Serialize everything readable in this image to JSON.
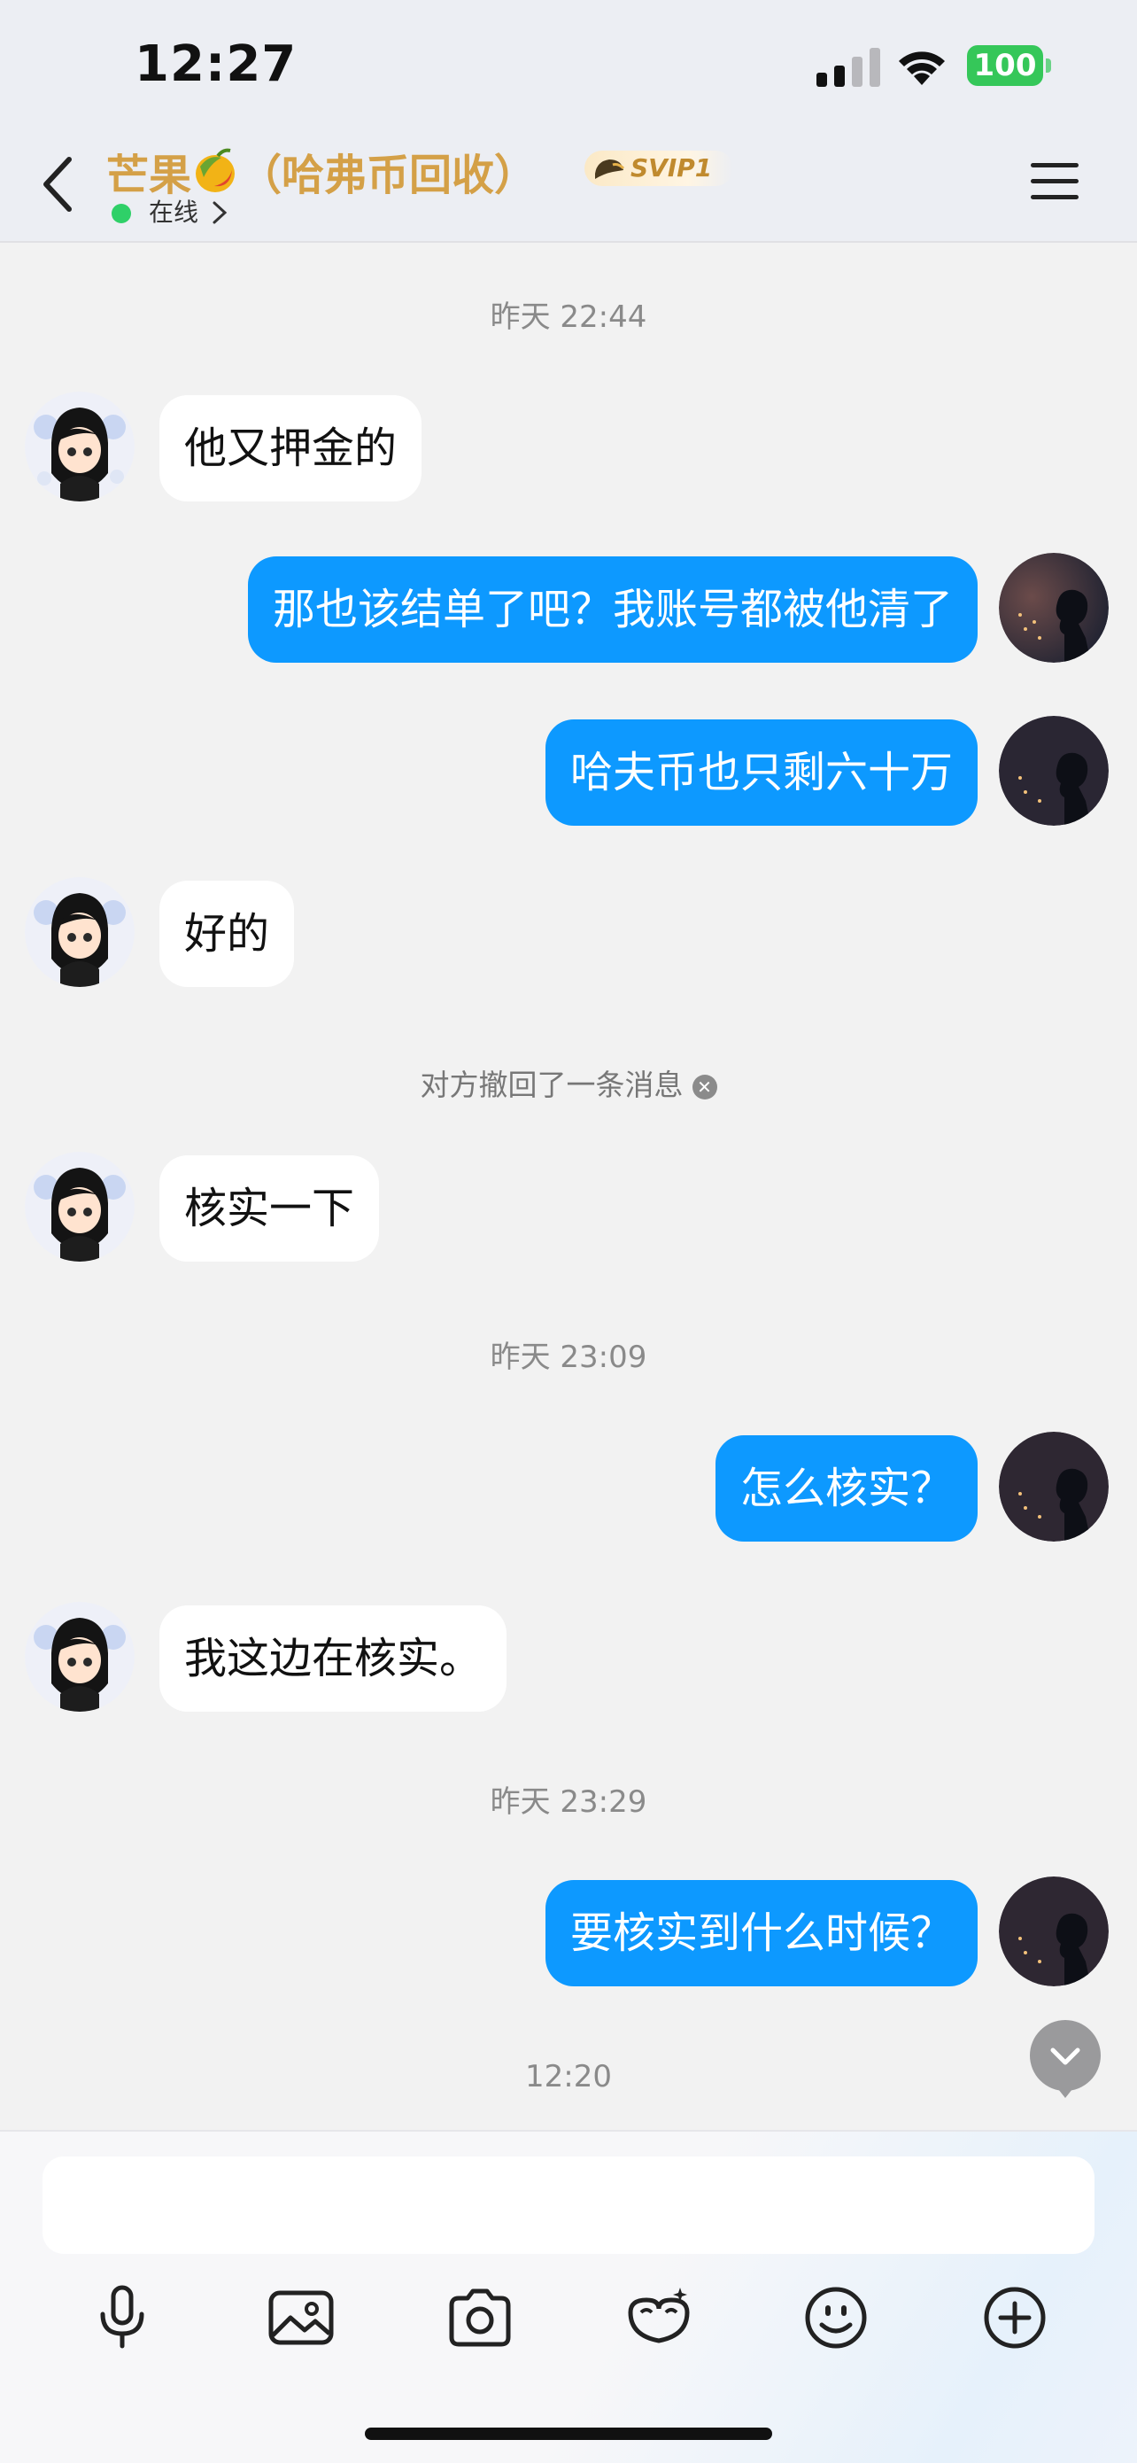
{
  "status_bar": {
    "time": "12:27",
    "battery": "100"
  },
  "header": {
    "name": "芒果",
    "name_suffix": "（哈弗币回收）",
    "vip": "SVIP1",
    "status": "在线"
  },
  "chat": {
    "timestamps": [
      "昨天 22:44",
      "昨天 23:09",
      "昨天 23:29",
      "12:20"
    ],
    "recall_notice": "对方撤回了一条消息",
    "messages": [
      {
        "side": "in",
        "text": "他又押金的"
      },
      {
        "side": "out",
        "text": "那也该结单了吧？我账号都被他清了"
      },
      {
        "side": "out",
        "text": "哈夫币也只剩六十万"
      },
      {
        "side": "in",
        "text": "好的"
      },
      {
        "side": "in",
        "text": "核实一下"
      },
      {
        "side": "out",
        "text": "怎么核实？"
      },
      {
        "side": "in",
        "text": "我这边在核实。"
      },
      {
        "side": "out",
        "text": "要核实到什么时候？"
      }
    ]
  },
  "input": {
    "placeholder": "",
    "value": ""
  },
  "icons": {
    "toolbar": [
      "microphone-icon",
      "image-icon",
      "camera-icon",
      "mask-icon",
      "emoji-icon",
      "plus-icon"
    ],
    "online_color": "#2fd068",
    "outgoing_bubble_color": "#0d99ff",
    "title_color": "#d4a047"
  }
}
